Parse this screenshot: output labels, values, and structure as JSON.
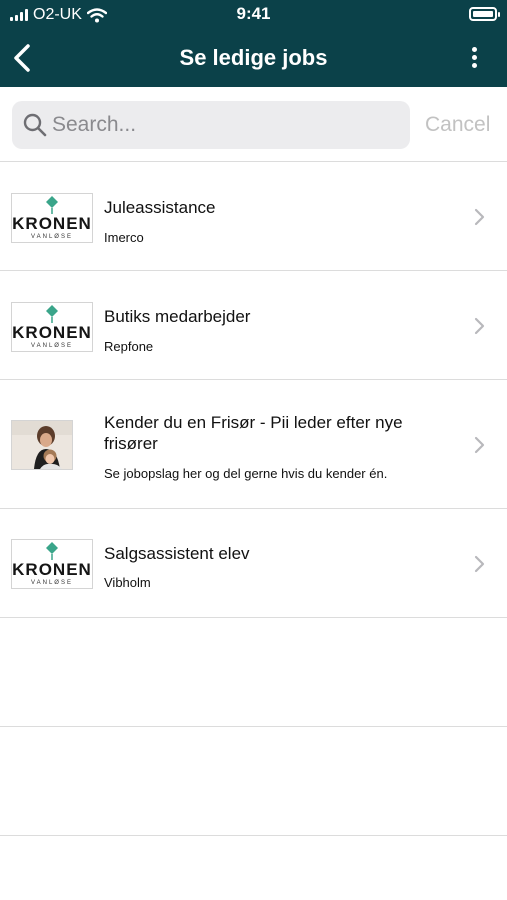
{
  "status_bar": {
    "carrier": "O2-UK",
    "time": "9:41"
  },
  "nav": {
    "title": "Se ledige jobs"
  },
  "search": {
    "placeholder": "Search...",
    "cancel_label": "Cancel"
  },
  "logo": {
    "name": "KRONEN",
    "sub": "VANLØSE"
  },
  "jobs": [
    {
      "title": "Juleassistance",
      "subtitle": "Imerco",
      "thumb": "kronen-logo"
    },
    {
      "title": "Butiks medarbejder",
      "subtitle": "Repfone",
      "thumb": "kronen-logo"
    },
    {
      "title": "Kender du en Frisør - Pii leder efter nye frisører",
      "subtitle": "Se jobopslag her og del gerne hvis du kender én.",
      "thumb": "hairdresser-photo"
    },
    {
      "title": "Salgsassistent elev",
      "subtitle": "Vibholm",
      "thumb": "kronen-logo"
    }
  ],
  "colors": {
    "header": "#0b4149",
    "logo_leaf": "#3aa58a",
    "divider": "#dcdcdc"
  }
}
